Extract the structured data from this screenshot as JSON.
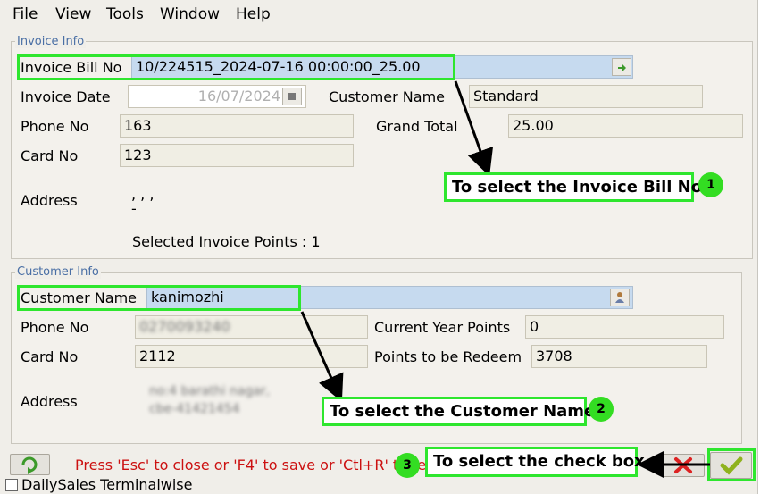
{
  "menu": {
    "file": "File",
    "view": "View",
    "tools": "Tools",
    "window": "Window",
    "help": "Help"
  },
  "invoice_info": {
    "title": "Invoice Info",
    "bill_no_label": "Invoice Bill No",
    "bill_no_value": "10/224515_2024-07-16 00:00:00_25.00",
    "invoice_date_label": "Invoice Date",
    "invoice_date_value": "16/07/2024",
    "customer_name_label": "Customer Name",
    "customer_name_value": "Standard",
    "phone_label": "Phone No",
    "phone_value": "163",
    "grand_total_label": "Grand Total",
    "grand_total_value": "25.00",
    "card_label": "Card No",
    "card_value": "123",
    "address_label": "Address",
    "address_line1": ", , ,",
    "address_line2": "-",
    "points_text": "Selected Invoice Points : 1"
  },
  "customer_info": {
    "title": "Customer Info",
    "name_label": "Customer Name",
    "name_value": "kanimozhi",
    "phone_label": "Phone No",
    "phone_value": "0270093240",
    "current_points_label": "Current Year Points",
    "current_points_value": "0",
    "card_label": "Card No",
    "card_value": "2112",
    "redeem_label": "Points to be Redeem",
    "redeem_value": "3708",
    "address_label": "Address",
    "address_line1": "no:4 barathi nagar,",
    "address_line2": "cbe-41421454"
  },
  "footer": {
    "hint": "Press 'Esc' to close or 'F4' to save or 'Ctl+R' to reset fields"
  },
  "callouts": {
    "one_text": "To select the Invoice Bill No",
    "one_num": "1",
    "two_text": "To select the Customer Name",
    "two_num": "2",
    "three_text": "To select the check box",
    "three_num": "3"
  },
  "background": {
    "list_item": "DailySales Terminalwise"
  },
  "colors": {
    "highlight": "#2ee62e",
    "hint_red": "#cc1111",
    "group_title": "#4a6fa5",
    "combo_blue": "#c6daef"
  }
}
